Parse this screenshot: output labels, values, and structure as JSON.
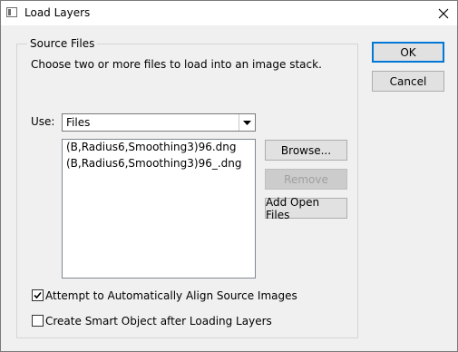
{
  "window": {
    "title": "Load Layers"
  },
  "buttons": {
    "ok": "OK",
    "cancel": "Cancel",
    "browse": "Browse...",
    "remove": "Remove",
    "add_open_files": "Add Open Files"
  },
  "source_files": {
    "group_label": "Source Files",
    "description": "Choose two or more files to load into an image stack.",
    "use_label": "Use:",
    "use_selected": "Files",
    "files": [
      "(B,Radius6,Smoothing3)96.dng",
      "(B,Radius6,Smoothing3)96_.dng"
    ]
  },
  "options": {
    "align_label": "Attempt to Automatically Align Source Images",
    "align_checked": true,
    "smart_object_label": "Create Smart Object after Loading Layers",
    "smart_object_checked": false
  }
}
